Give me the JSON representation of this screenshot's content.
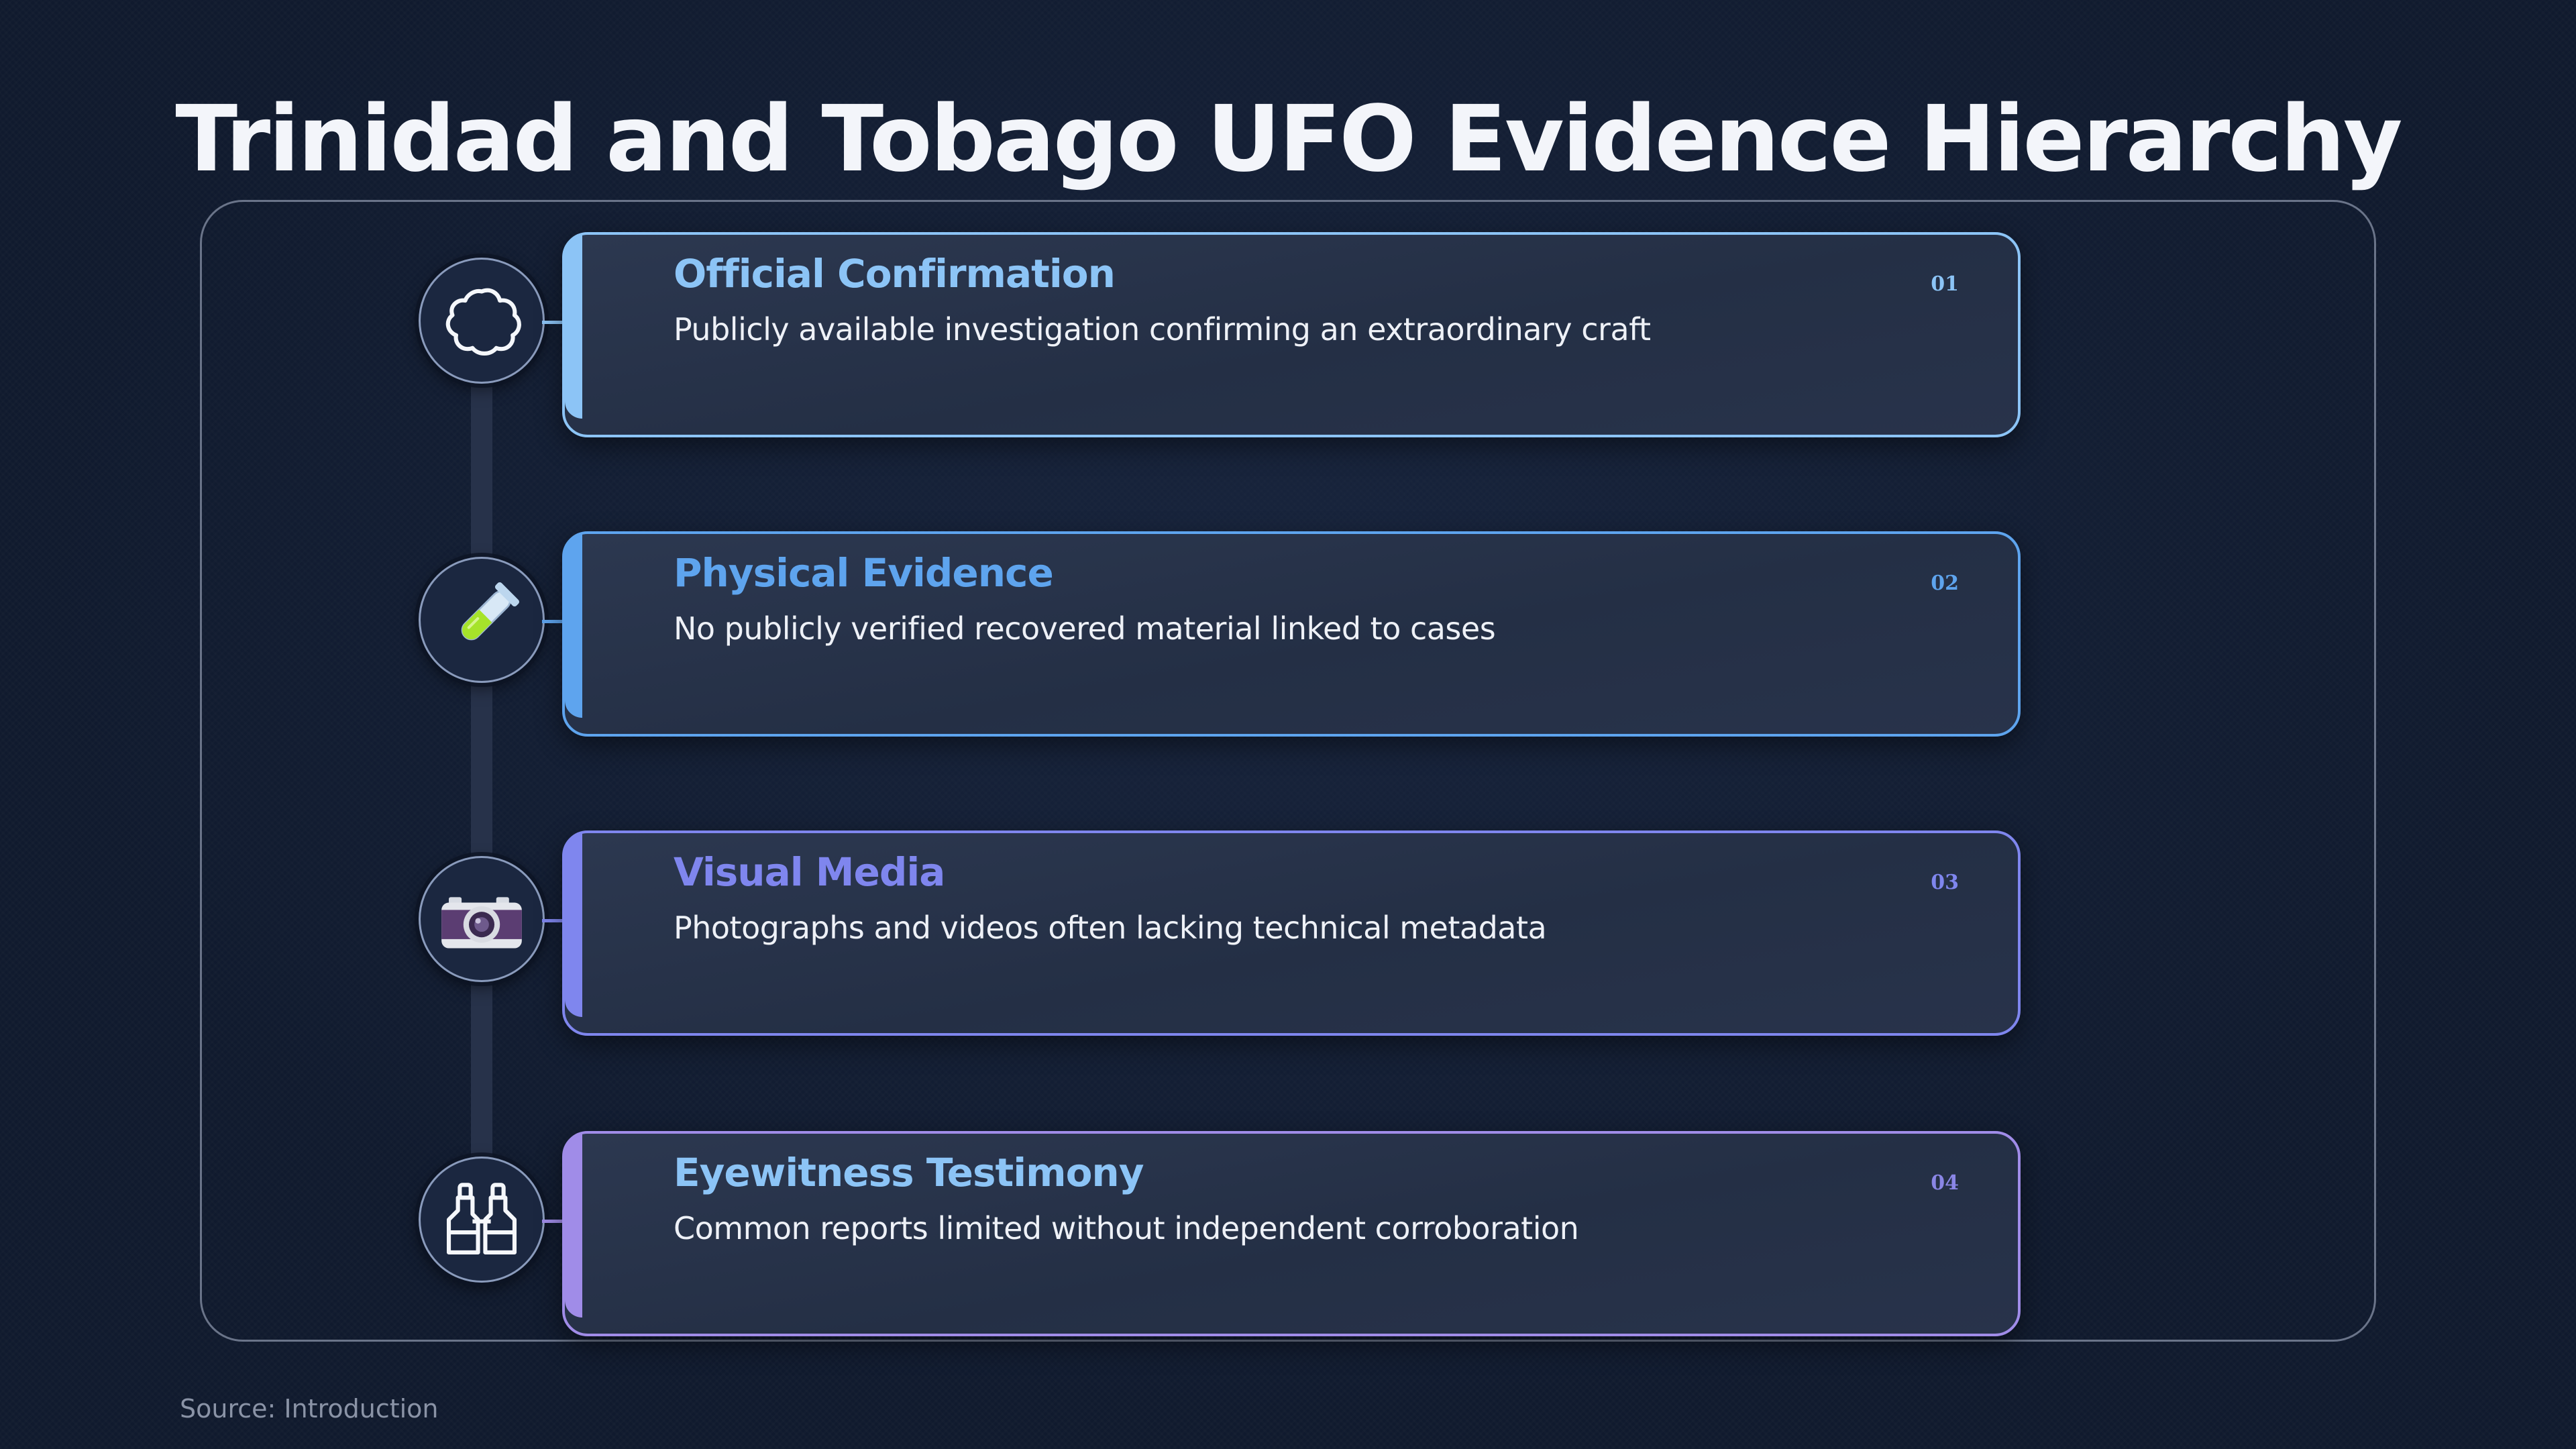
{
  "title": "Trinidad and Tobago UFO Evidence Hierarchy",
  "items": [
    {
      "number": "01",
      "title": "Official Confirmation",
      "description": "Publicly available investigation confirming an extraordinary craft",
      "icon": "cloud-icon",
      "color": "#8cc4f6"
    },
    {
      "number": "02",
      "title": "Physical Evidence",
      "description": "No publicly verified recovered material linked to cases",
      "icon": "test-tube-icon",
      "color": "#5ea4ee"
    },
    {
      "number": "03",
      "title": "Visual Media",
      "description": "Photographs and videos often lacking technical metadata",
      "icon": "camera-icon",
      "color": "#7f86ee"
    },
    {
      "number": "04",
      "title": "Eyewitness Testimony",
      "description": "Common reports limited without independent corroboration",
      "icon": "binoculars-icon",
      "color": "#a08ce8"
    }
  ],
  "source": "Source: Introduction"
}
